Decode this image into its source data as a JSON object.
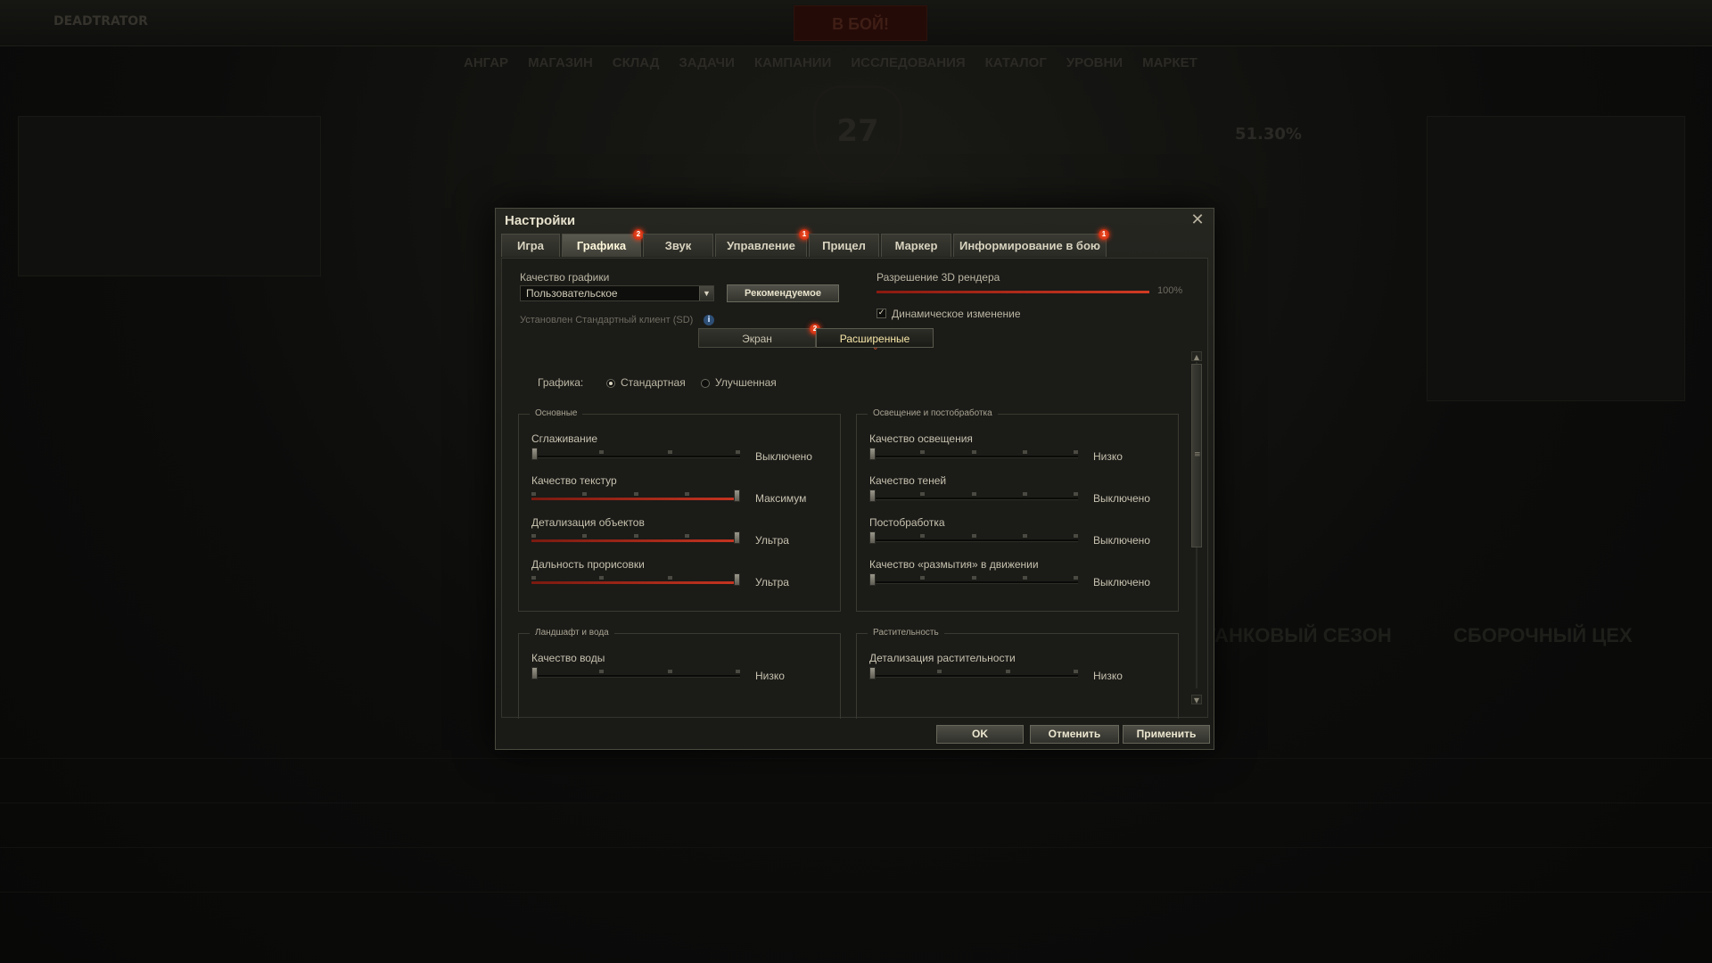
{
  "background": {
    "nick": "DEADTRATOR",
    "battle_button": "В БОЙ!",
    "nav": [
      "АНГАР",
      "МАГАЗИН",
      "СКЛАД",
      "ЗАДАЧИ",
      "КАМПАНИИ",
      "ИССЛЕДОВАНИЯ",
      "ИССЛЕДОВАНИЯ",
      "КАТАЛОГ",
      "УРОВНИ",
      "МАРКЕТ"
    ],
    "emblem_number": "27",
    "winrate": "51.30%",
    "season_left": "ТАНКОВЫЙ СЕЗОН",
    "season_right": "СБОРОЧНЫЙ ЦЕХ"
  },
  "dialog": {
    "title": "Настройки",
    "close_symbol": "✕",
    "tabs": [
      {
        "label": "Игра",
        "badge": ""
      },
      {
        "label": "Графика",
        "badge": "2"
      },
      {
        "label": "Звук",
        "badge": ""
      },
      {
        "label": "Управление",
        "badge": "1"
      },
      {
        "label": "Прицел",
        "badge": ""
      },
      {
        "label": "Маркер",
        "badge": ""
      },
      {
        "label": "Информирование в бою",
        "badge": "1"
      }
    ],
    "active_tab": "Графика",
    "quality": {
      "label": "Качество графики",
      "selected": "Пользовательское",
      "recommended_button": "Рекомендуемое",
      "client_note": "Установлен Стандартный клиент (SD)",
      "info_symbol": "i"
    },
    "render": {
      "label": "Разрешение 3D рендера",
      "value_text": "100%",
      "value": 1.0,
      "dynamic_label": "Динамическое изменение",
      "dynamic_checked": true,
      "check_symbol": "✓"
    },
    "subtabs": [
      {
        "label": "Экран",
        "badge": "2"
      },
      {
        "label": "Расширенные",
        "badge": ""
      }
    ],
    "active_subtab": "Расширенные",
    "graphics_mode": {
      "label": "Графика:",
      "options": [
        "Стандартная",
        "Улучшенная"
      ],
      "selected": "Стандартная"
    },
    "groups": {
      "basic": {
        "title": "Основные",
        "rows": [
          {
            "label": "Сглаживание",
            "value": "Выключено",
            "steps": 4,
            "level": 0
          },
          {
            "label": "Качество текстур",
            "value": "Максимум",
            "steps": 5,
            "level": 4
          },
          {
            "label": "Детализация объектов",
            "value": "Ультра",
            "steps": 5,
            "level": 4
          },
          {
            "label": "Дальность прорисовки",
            "value": "Ультра",
            "steps": 4,
            "level": 3
          }
        ]
      },
      "lighting": {
        "title": "Освещение и постобработка",
        "rows": [
          {
            "label": "Качество освещения",
            "value": "Низко",
            "steps": 5,
            "level": 0
          },
          {
            "label": "Качество теней",
            "value": "Выключено",
            "steps": 5,
            "level": 0
          },
          {
            "label": "Постобработка",
            "value": "Выключено",
            "steps": 5,
            "level": 0
          },
          {
            "label": "Качество «размытия» в движении",
            "value": "Выключено",
            "steps": 5,
            "level": 0
          }
        ]
      },
      "landscape": {
        "title": "Ландшафт и вода",
        "rows": [
          {
            "label": "Качество воды",
            "value": "Низко",
            "steps": 4,
            "level": 0
          }
        ]
      },
      "vegetation": {
        "title": "Растительность",
        "rows": [
          {
            "label": "Детализация растительности",
            "value": "Низко",
            "steps": 4,
            "level": 0
          }
        ]
      }
    },
    "footer": {
      "ok": "OK",
      "cancel": "Отменить",
      "apply": "Применить"
    },
    "scroll_symbols": {
      "up": "▲",
      "down": "▼",
      "grip": "≡",
      "dropdown": "▼",
      "caret": "⌄"
    }
  }
}
